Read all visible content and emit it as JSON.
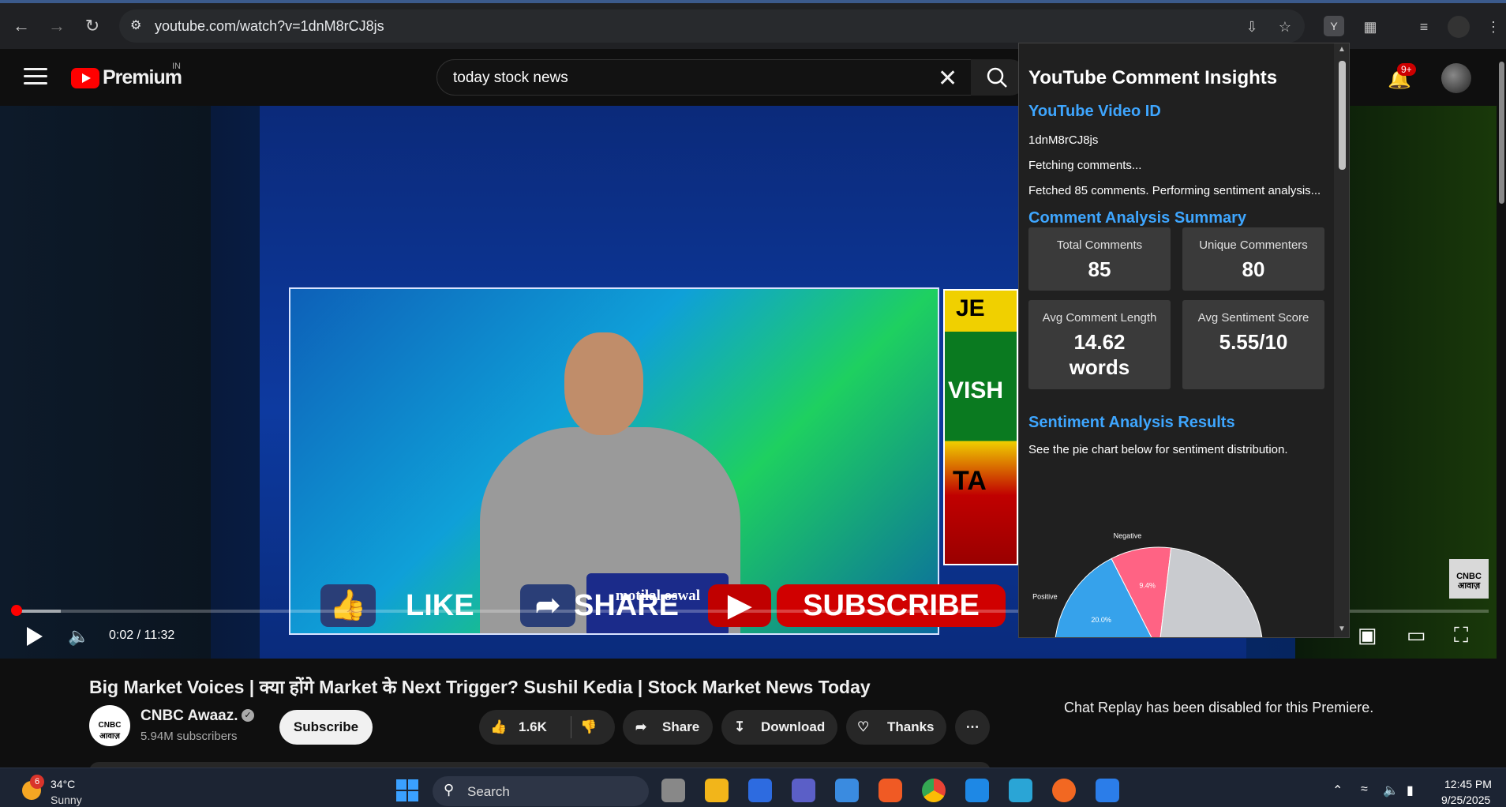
{
  "browser": {
    "url": "youtube.com/watch?v=1dnM8rCJ8js",
    "ext_label": "Y"
  },
  "youtube": {
    "logo_text": "Premium",
    "country": "IN",
    "search_value": "today stock news",
    "notification_count": "9+"
  },
  "video": {
    "brand_on_desk": "motilal oswal",
    "cta_like": "LIKE",
    "cta_share": "SHARE",
    "cta_subscribe": "SUBSCRIBE",
    "channel_bug": "CNBC आवाज़",
    "side_top": "JE",
    "side_mid": "VISH",
    "side_bottom": "TA",
    "current_time": "0:02 / 11:32",
    "progress_percent": 0.3
  },
  "below": {
    "title": "Big Market Voices | क्या होंगे Market के Next Trigger? Sushil Kedia | Stock Market News Today",
    "channel_name": "CNBC Awaaz.",
    "channel_avatar_text": "CNBC आवाज़",
    "subscribers": "5.94M subscribers",
    "subscribe_label": "Subscribe",
    "likes": "1.6K",
    "share_label": "Share",
    "download_label": "Download",
    "thanks_label": "Thanks",
    "chat_replay": "Chat Replay has been disabled for this Premiere."
  },
  "extension": {
    "title": "YouTube Comment Insights",
    "video_id_heading": "YouTube Video ID",
    "video_id": "1dnM8rCJ8js",
    "status1": "Fetching comments...",
    "status2": "Fetched 85 comments. Performing sentiment analysis...",
    "summary_heading": "Comment Analysis Summary",
    "cards": [
      {
        "label": "Total Comments",
        "value": "85"
      },
      {
        "label": "Unique Commenters",
        "value": "80"
      },
      {
        "label": "Avg Comment Length",
        "value": "14.62 words"
      },
      {
        "label": "Avg Sentiment Score",
        "value": "5.55/10"
      }
    ],
    "results_heading": "Sentiment Analysis Results",
    "results_text": "See the pie chart below for sentiment distribution."
  },
  "chart_data": {
    "type": "pie",
    "slices": [
      {
        "label": "Positive",
        "value": 20.0,
        "display": "20.0%",
        "color": "#36a2eb"
      },
      {
        "label": "Negative",
        "value": 9.4,
        "display": "9.4%",
        "color": "#ff6384"
      },
      {
        "label": "",
        "value": 70.6,
        "display": "",
        "color": "#c9cbcf"
      }
    ]
  },
  "taskbar": {
    "weather_badge": "6",
    "temperature": "34°C",
    "condition": "Sunny",
    "search_label": "Search",
    "time": "12:45 PM",
    "date": "9/25/2025"
  }
}
